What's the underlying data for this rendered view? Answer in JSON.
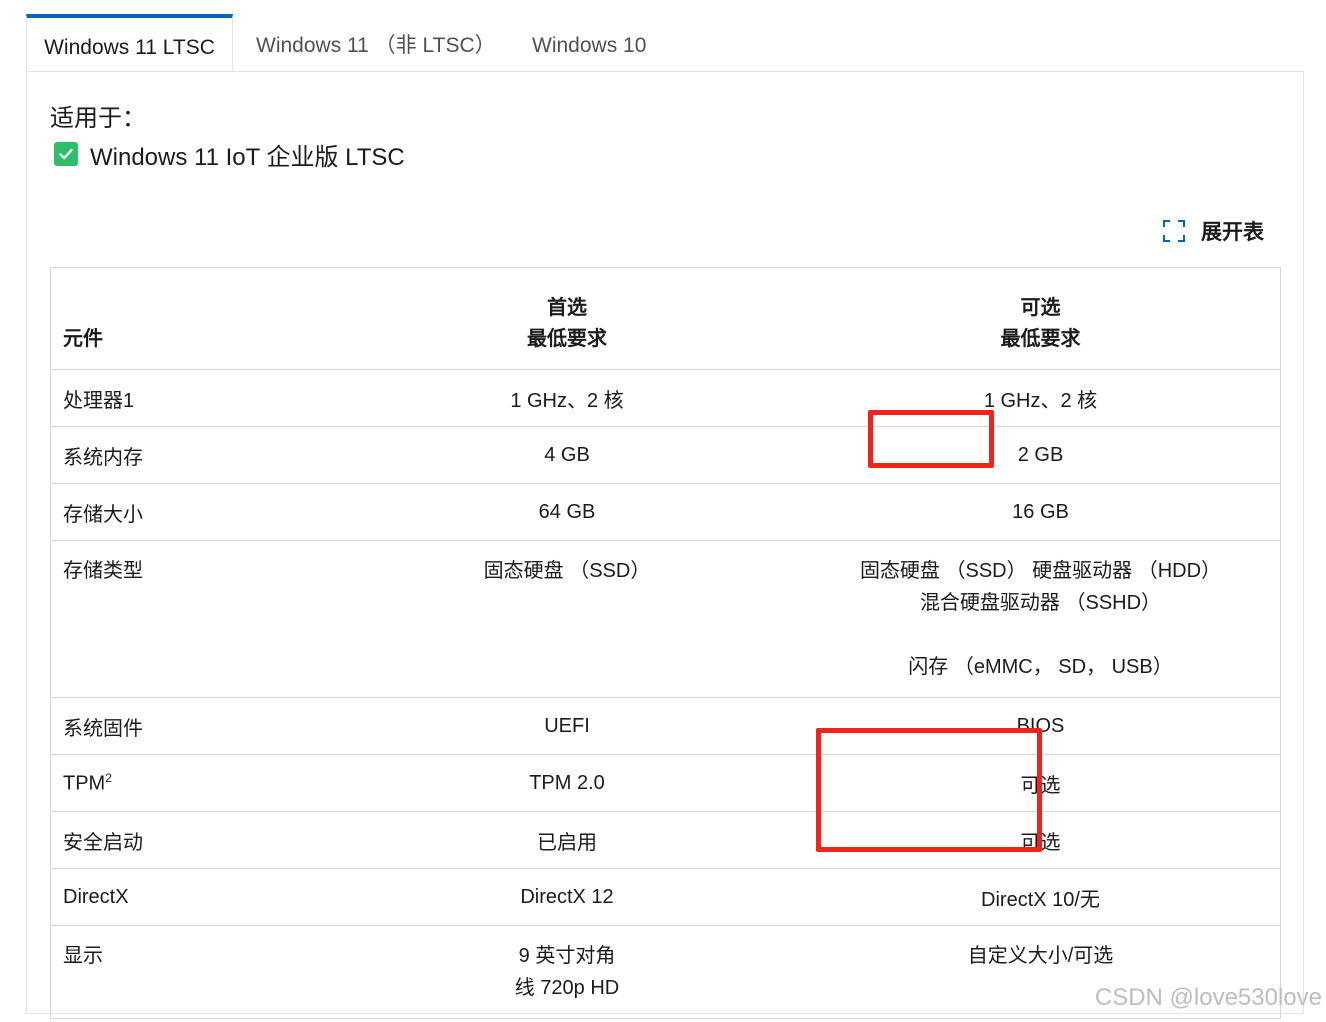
{
  "tabs": [
    "Windows 11 LTSC",
    "Windows 11 （非 LTSC）",
    "Windows 10"
  ],
  "applies_to": {
    "title": "适用于：",
    "item": "Windows 11 IoT 企业版 LTSC",
    "checked": true
  },
  "expand_button": {
    "label": "展开表",
    "icon": "expand-icon"
  },
  "table": {
    "headers": {
      "component": "元件",
      "preferred_line1": "首选",
      "preferred_line2": "最低要求",
      "optional_line1": "可选",
      "optional_line2": "最低要求"
    },
    "rows": [
      {
        "component": "处理器1",
        "preferred": [
          "1 GHz、2 核"
        ],
        "optional": [
          "1 GHz、2 核"
        ]
      },
      {
        "component": "系统内存",
        "preferred": [
          "4 GB"
        ],
        "optional": [
          "2 GB"
        ]
      },
      {
        "component": "存储大小",
        "preferred": [
          "64 GB"
        ],
        "optional": [
          "16 GB"
        ]
      },
      {
        "component": "存储类型",
        "preferred": [
          "固态硬盘 （SSD）"
        ],
        "optional": [
          "固态硬盘 （SSD） 硬盘驱动器 （HDD）",
          "混合硬盘驱动器 （SSHD）",
          "",
          "闪存 （eMMC， SD， USB）"
        ]
      },
      {
        "component": "系统固件",
        "preferred": [
          "UEFI"
        ],
        "optional": [
          "BIOS"
        ]
      },
      {
        "component": "TPM",
        "component_sup": "2",
        "preferred": [
          "TPM 2.0"
        ],
        "optional": [
          "可选"
        ]
      },
      {
        "component": "安全启动",
        "preferred": [
          "已启用"
        ],
        "optional": [
          "可选"
        ]
      },
      {
        "component": "DirectX",
        "preferred": [
          "DirectX 12"
        ],
        "optional": [
          "DirectX 10/无"
        ]
      },
      {
        "component": "显示",
        "preferred": [
          "9 英寸对角",
          "线 720p HD"
        ],
        "optional": [
          "自定义大小/可选"
        ]
      }
    ]
  },
  "colors": {
    "tab_accent": "#0067b8",
    "check_green": "#2ebd6b",
    "highlight_red": "#f2221c"
  },
  "watermark": "CSDN @love530love"
}
